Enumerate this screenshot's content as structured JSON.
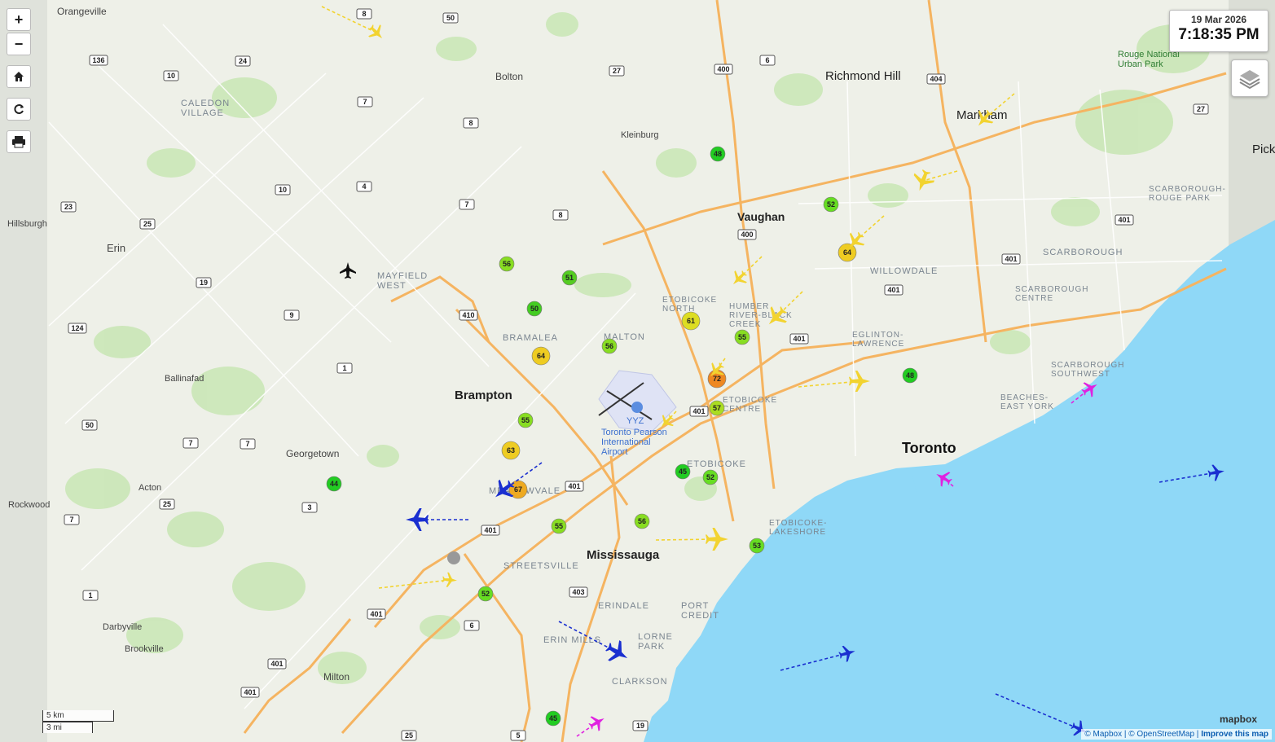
{
  "toolbar": {
    "zoom_in": "+",
    "zoom_out": "−",
    "home_icon": "home-icon",
    "refresh_icon": "refresh-icon",
    "print_icon": "print-icon"
  },
  "clock": {
    "date": "19 Mar 2026",
    "time": "7:18:35 PM"
  },
  "layers_icon": "layers-icon",
  "scale": {
    "metric": "5 km",
    "imperial": "3 mi"
  },
  "attribution": {
    "mapbox": "© Mapbox",
    "osm": "© OpenStreetMap",
    "improve": "Improve this map",
    "logo": "mapbox"
  },
  "places": {
    "orangeville": "Orangeville",
    "bolton": "Bolton",
    "caledon_village": "CALEDON\nVILLAGE",
    "kleinburg": "Kleinburg",
    "richmond_hill": "Richmond Hill",
    "markham": "Markham",
    "rouge_park": "Rouge National\nUrban Park",
    "pick": "Pick",
    "hillsburgh": "Hillsburgh",
    "erin": "Erin",
    "vaughan": "Vaughan",
    "mayfield_west": "MAYFIELD\nWEST",
    "scarborough_rouge_park": "SCARBOROUGH-\nROUGE PARK",
    "willowdale": "WILLOWDALE",
    "scarborough": "SCARBOROUGH",
    "bramalea": "BRAMALEA",
    "etobicoke_north": "ETOBICOKE\nNORTH",
    "humber_river": "HUMBER\nRIVER-BLACK\nCREEK",
    "scarborough_centre": "SCARBOROUGH\nCENTRE",
    "malton": "MALTON",
    "eglinton_lawrence": "EGLINTON-\nLAWRENCE",
    "ballinafad": "Ballinafad",
    "scarborough_southwest": "SCARBOROUGH\nSOUTHWEST",
    "brampton": "Brampton",
    "etobicoke_centre": "ETOBICOKE\nCENTRE",
    "beaches": "BEACHES-\nEAST YORK",
    "yyz": "YYZ",
    "pearson": "Toronto Pearson\nInternational\nAirport",
    "georgetown": "Georgetown",
    "toronto": "Toronto",
    "etobicoke": "ETOBICOKE",
    "acton": "Acton",
    "meadowvale": "MEADOWVALE",
    "rockwood": "Rockwood",
    "etobicoke_lakeshore": "ETOBICOKE-\nLAKESHORE",
    "mississauga": "Mississauga",
    "streetsville": "STREETSVILLE",
    "erindale": "ERINDALE",
    "port_credit": "PORT\nCREDIT",
    "darbyville": "Darbyville",
    "erin_mills": "ERIN MILLS",
    "lorne_park": "LORNE\nPARK",
    "brookville": "Brookville",
    "clarkson": "CLARKSON",
    "milton": "Milton"
  },
  "route_shields": [
    "8",
    "50",
    "136",
    "24",
    "10",
    "7",
    "27",
    "400",
    "6",
    "404",
    "27",
    "8",
    "10",
    "4",
    "7",
    "8",
    "23",
    "25",
    "19",
    "9",
    "410",
    "124",
    "1",
    "401",
    "400",
    "401",
    "401",
    "401",
    "50",
    "7",
    "7",
    "401",
    "3",
    "25",
    "7",
    "401",
    "401",
    "403",
    "6",
    "1",
    "401",
    "401",
    "25",
    "5",
    "19",
    "401"
  ],
  "aqi_stations": [
    {
      "value": 48,
      "color": "#22cc22"
    },
    {
      "value": 52,
      "color": "#66dd22"
    },
    {
      "value": 56,
      "color": "#88dd22"
    },
    {
      "value": 51,
      "color": "#55cc22"
    },
    {
      "value": 64,
      "color": "#eecc22"
    },
    {
      "value": 50,
      "color": "#44cc22"
    },
    {
      "value": 61,
      "color": "#dddd22"
    },
    {
      "value": 55,
      "color": "#88dd22"
    },
    {
      "value": 64,
      "color": "#eecc22"
    },
    {
      "value": 56,
      "color": "#88dd22"
    },
    {
      "value": 72,
      "color": "#ee8822"
    },
    {
      "value": 48,
      "color": "#22cc22"
    },
    {
      "value": 57,
      "color": "#aadd22"
    },
    {
      "value": 55,
      "color": "#88dd22"
    },
    {
      "value": 63,
      "color": "#eecc22"
    },
    {
      "value": 67,
      "color": "#eeaa22"
    },
    {
      "value": 45,
      "color": "#22cc22"
    },
    {
      "value": 52,
      "color": "#66dd22"
    },
    {
      "value": 44,
      "color": "#22cc22"
    },
    {
      "value": 56,
      "color": "#88dd22"
    },
    {
      "value": 55,
      "color": "#88dd22"
    },
    {
      "value": 53,
      "color": "#66dd22"
    },
    {
      "value": 52,
      "color": "#66dd22"
    },
    {
      "value": 45,
      "color": "#22cc22"
    }
  ],
  "aircraft_colors": {
    "yellow": "#f2d330",
    "blue": "#1a2fd0",
    "magenta": "#e022e0",
    "black": "#111111"
  },
  "colors": {
    "water": "#8fd8f7",
    "land": "#eef0e8",
    "highway": "#f5b461",
    "park": "#c8e6b4"
  }
}
